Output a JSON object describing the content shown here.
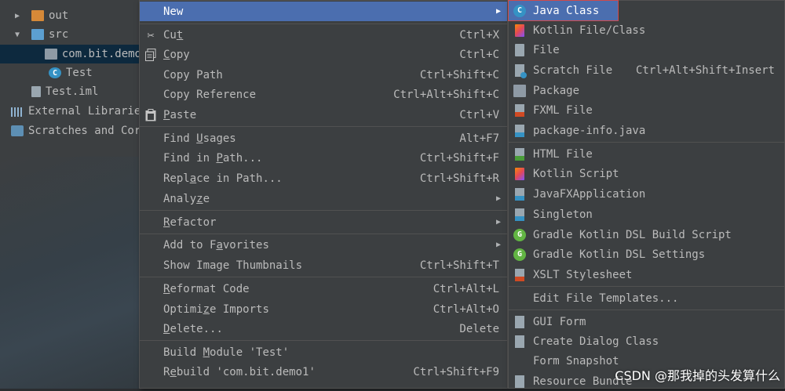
{
  "tree": {
    "items": [
      {
        "label": "out",
        "arrow": "▶"
      },
      {
        "label": "src",
        "arrow": "▼"
      },
      {
        "label": "com.bit.demo"
      },
      {
        "label": "Test",
        "icon_letter": "C"
      },
      {
        "label": "Test.iml"
      },
      {
        "label": "External Librarie"
      },
      {
        "label": "Scratches and Cor"
      }
    ]
  },
  "menu": {
    "new": {
      "label": "New",
      "submenu_arrow": "▶"
    },
    "cut": {
      "pre": "Cu",
      "u": "t",
      "post": "",
      "shortcut": "Ctrl+X",
      "icon": "scissors-icon"
    },
    "copy": {
      "pre": "",
      "u": "C",
      "post": "opy",
      "shortcut": "Ctrl+C",
      "icon": "copy-icon"
    },
    "copy_path": {
      "label": "Copy Path",
      "shortcut": "Ctrl+Shift+C"
    },
    "copy_reference": {
      "label": "Copy Reference",
      "shortcut": "Ctrl+Alt+Shift+C"
    },
    "paste": {
      "pre": "",
      "u": "P",
      "post": "aste",
      "shortcut": "Ctrl+V",
      "icon": "clipboard-icon"
    },
    "find_usages": {
      "pre": "Find ",
      "u": "U",
      "post": "sages",
      "shortcut": "Alt+F7"
    },
    "find_in_path": {
      "pre": "Find in ",
      "u": "P",
      "post": "ath...",
      "shortcut": "Ctrl+Shift+F"
    },
    "replace_in_path": {
      "pre": "Repl",
      "u": "a",
      "post": "ce in Path...",
      "shortcut": "Ctrl+Shift+R"
    },
    "analyze": {
      "pre": "Analy",
      "u": "z",
      "post": "e",
      "submenu_arrow": "▶"
    },
    "refactor": {
      "pre": "",
      "u": "R",
      "post": "efactor",
      "submenu_arrow": "▶"
    },
    "add_to_favorites": {
      "pre": "Add to F",
      "u": "a",
      "post": "vorites",
      "submenu_arrow": "▶"
    },
    "show_image_thumbnails": {
      "label": "Show Image Thumbnails",
      "shortcut": "Ctrl+Shift+T"
    },
    "reformat_code": {
      "pre": "",
      "u": "R",
      "post": "eformat Code",
      "shortcut": "Ctrl+Alt+L"
    },
    "optimize_imports": {
      "pre": "Optimi",
      "u": "z",
      "post": "e Imports",
      "shortcut": "Ctrl+Alt+O"
    },
    "delete": {
      "pre": "",
      "u": "D",
      "post": "elete...",
      "shortcut": "Delete"
    },
    "build_module": {
      "pre": "Build ",
      "u": "M",
      "post": "odule 'Test'"
    },
    "rebuild": {
      "pre": "R",
      "u": "e",
      "post": "build 'com.bit.demo1'",
      "shortcut": "Ctrl+Shift+F9"
    }
  },
  "submenu": {
    "items": [
      {
        "label": "Java Class",
        "icon": "java-class-icon",
        "icon_letter": "C"
      },
      {
        "label": "Kotlin File/Class",
        "icon": "kotlin-file-icon"
      },
      {
        "label": "File",
        "icon": "file-icon"
      },
      {
        "label": "Scratch File",
        "icon": "scratch-file-icon",
        "shortcut": "Ctrl+Alt+Shift+Insert"
      },
      {
        "label": "Package",
        "icon": "package-icon"
      },
      {
        "label": "FXML File",
        "icon": "fxml-file-icon"
      },
      {
        "label": "package-info.java",
        "icon": "java-doc-icon"
      },
      {
        "label": "HTML File",
        "icon": "html-file-icon"
      },
      {
        "label": "Kotlin Script",
        "icon": "kotlin-script-icon"
      },
      {
        "label": "JavaFXApplication",
        "icon": "javafx-icon"
      },
      {
        "label": "Singleton",
        "icon": "singleton-icon"
      },
      {
        "label": "Gradle Kotlin DSL Build Script",
        "icon": "gradle-icon",
        "icon_letter": "G"
      },
      {
        "label": "Gradle Kotlin DSL Settings",
        "icon": "gradle-icon",
        "icon_letter": "G"
      },
      {
        "label": "XSLT Stylesheet",
        "icon": "xslt-icon"
      },
      {
        "label": "Edit File Templates..."
      },
      {
        "label": "GUI Form",
        "icon": "gui-form-icon"
      },
      {
        "label": "Create Dialog Class",
        "icon": "dialog-class-icon"
      },
      {
        "label": "Form Snapshot"
      },
      {
        "label": "Resource Bundle",
        "icon": "resource-bundle-icon"
      }
    ]
  },
  "watermark": "CSDN @那我掉的头发算什么",
  "colors": {
    "menu_bg": "#3c3f41",
    "selection": "#4b6eaf",
    "highlight_border": "#d04a4a",
    "text": "#bbbbbb"
  }
}
